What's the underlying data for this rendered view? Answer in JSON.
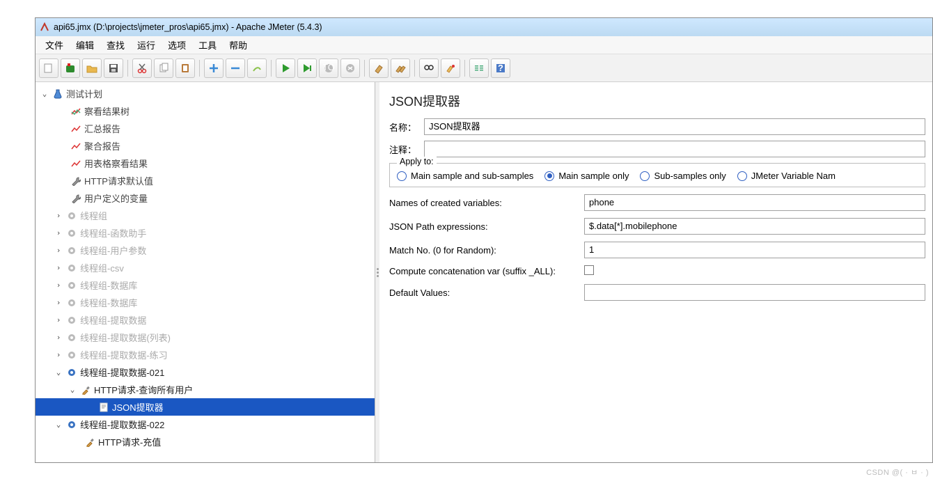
{
  "window_title": "api65.jmx (D:\\projects\\jmeter_pros\\api65.jmx) - Apache JMeter (5.4.3)",
  "menubar": [
    "文件",
    "编辑",
    "查找",
    "运行",
    "选项",
    "工具",
    "帮助"
  ],
  "toolbar": [
    "new",
    "templates",
    "open",
    "save",
    "cut",
    "copy",
    "paste",
    "add",
    "remove",
    "wipe",
    "start",
    "start-no-pause",
    "stop",
    "shutdown",
    "clear",
    "clear-all",
    "search",
    "reset-search",
    "fn-helper",
    "help"
  ],
  "tree": {
    "root": "测试计划",
    "reports": [
      "察看结果树",
      "汇总报告",
      "聚合报告",
      "用表格察看结果"
    ],
    "defaults": [
      "HTTP请求默认值",
      "用户定义的变量"
    ],
    "tg_grey": [
      "线程组",
      "线程组-函数助手",
      "线程组-用户参数",
      "线程组-csv",
      "线程组-数据库",
      "线程组-数据库",
      "线程组-提取数据",
      "线程组-提取数据(列表)",
      "线程组-提取数据-练习"
    ],
    "tg_blue_1": "线程组-提取数据-021",
    "http_1": "HTTP请求-查询所有用户",
    "json_extractor": "JSON提取器",
    "tg_blue_2": "线程组-提取数据-022",
    "http_2": "HTTP请求-充值"
  },
  "panel": {
    "title": "JSON提取器",
    "label_name": "名称：",
    "label_comment": "注释：",
    "value_name": "JSON提取器",
    "value_comment": "",
    "fieldset_legend": "Apply to:",
    "radios": [
      "Main sample and sub-samples",
      "Main sample only",
      "Sub-samples only",
      "JMeter Variable Nam"
    ],
    "selected_radio": 1,
    "rows": {
      "names_lbl": "Names of created variables:",
      "names_val": "phone",
      "json_lbl": "JSON Path expressions:",
      "json_val": "$.data[*].mobilephone",
      "match_lbl": "Match No. (0 for Random):",
      "match_val": "1",
      "concat_lbl": "Compute concatenation var (suffix _ALL):",
      "concat_checked": false,
      "default_lbl": "Default Values:",
      "default_val": ""
    }
  },
  "watermark": "CSDN @( · ㅂ · )"
}
